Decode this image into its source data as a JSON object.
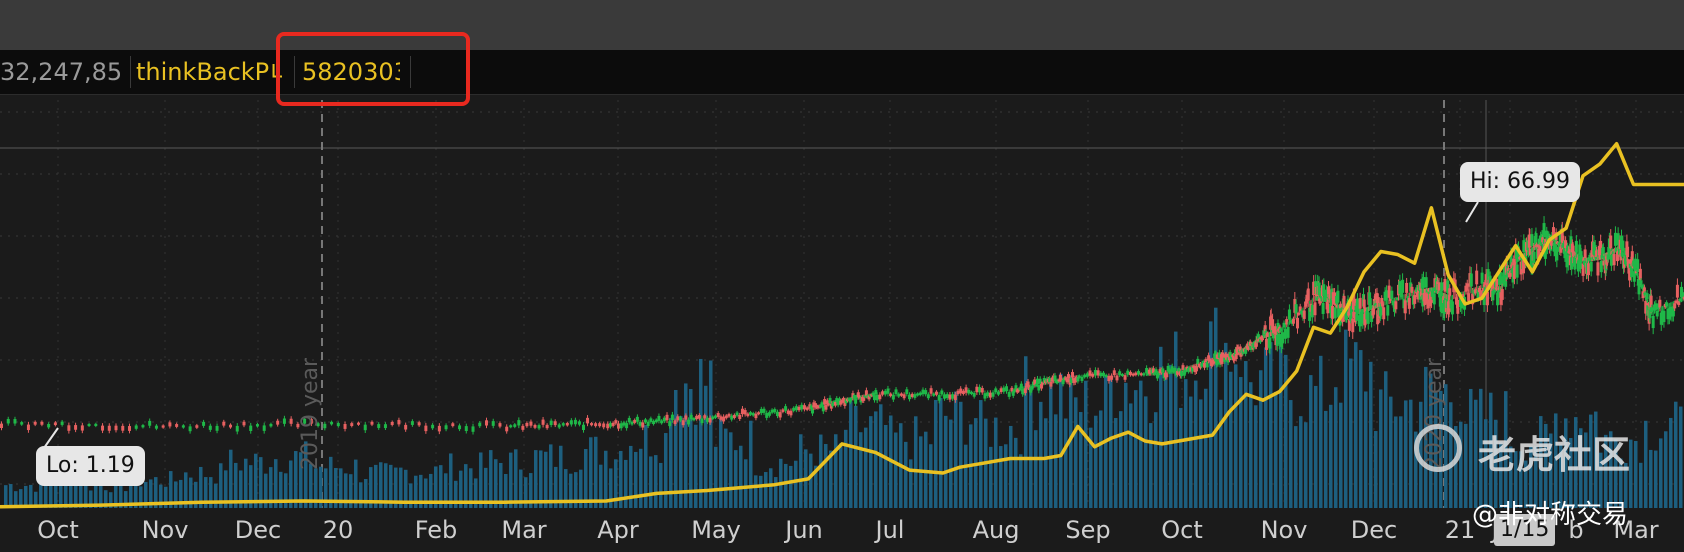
{
  "header": {
    "fields": [
      {
        "label": "32,247,85("
      },
      {
        "label": "thinkBackP∟"
      },
      {
        "label": "5820303"
      }
    ]
  },
  "callouts": {
    "lo": "Lo: 1.19",
    "hi": "Hi: 66.99"
  },
  "year_labels": [
    "2019 year",
    "2020 year"
  ],
  "date_badge": "1/15",
  "watermark": {
    "main": "老虎社区",
    "sub": "@非对称交易"
  },
  "colors": {
    "background": "#1b1b1b",
    "price_line": "#e9c122",
    "candle_up": "#1fb848",
    "candle_down": "#e66060",
    "volume": "#1d5f7f",
    "highlight": "#e8291f"
  },
  "chart_data": {
    "type": "line",
    "title": "",
    "x_ticks": [
      "Oct",
      "Nov",
      "Dec",
      "20",
      "Feb",
      "Mar",
      "Apr",
      "May",
      "Jun",
      "Jul",
      "Aug",
      "Sep",
      "Oct",
      "Nov",
      "Dec",
      "21",
      "Jan",
      "b",
      "Mar"
    ],
    "annotations": {
      "lo": 1.19,
      "hi": 66.99
    },
    "series": [
      {
        "style": "line",
        "x": [
          0,
          6,
          12,
          18,
          24,
          30,
          36,
          39,
          42,
          46,
          48,
          50,
          52,
          54,
          56,
          57,
          58,
          60,
          62,
          63,
          64,
          65,
          66,
          67,
          68,
          69,
          70,
          72,
          73,
          74,
          75,
          76,
          77,
          78,
          79,
          80,
          81,
          82,
          83,
          84,
          85,
          86,
          87,
          88,
          89,
          90,
          91,
          92,
          93,
          94,
          95,
          96,
          97,
          98,
          100
        ],
        "y": [
          0.2,
          0.5,
          1.0,
          1.2,
          1.0,
          1.0,
          1.2,
          2.5,
          3.0,
          4.0,
          5.0,
          11.0,
          9.5,
          6.5,
          6.0,
          7.0,
          7.5,
          8.5,
          8.5,
          9.0,
          14.0,
          10.5,
          12.0,
          13.0,
          11.5,
          11.0,
          11.5,
          12.5,
          16.5,
          19.5,
          18.5,
          20.0,
          23.5,
          31.0,
          30.0,
          34.5,
          40.5,
          44.0,
          43.5,
          42.0,
          51.5,
          40.0,
          35.0,
          36.0,
          40.5,
          45.0,
          40.5,
          46.0,
          48.0,
          57.0,
          59.0,
          62.5,
          55.5,
          55.5,
          55.5
        ]
      },
      {
        "style": "candles",
        "x": [
          0,
          10,
          20,
          30,
          36,
          40,
          44,
          48,
          50,
          52,
          56,
          60,
          62,
          64,
          68,
          70,
          72,
          73,
          74,
          75,
          76,
          78,
          79,
          80,
          81,
          82,
          84,
          85,
          86,
          88,
          89,
          90,
          91,
          92,
          93,
          94,
          95,
          96,
          97,
          98,
          100
        ],
        "y": [
          14.5,
          14.0,
          14.5,
          14.0,
          14.5,
          15.0,
          16.0,
          17.0,
          18.5,
          19.5,
          19.5,
          20.0,
          21.5,
          22.5,
          23.0,
          23.5,
          25.5,
          26.0,
          27.5,
          29.5,
          30.5,
          36.0,
          35.5,
          33.0,
          34.0,
          35.0,
          37.0,
          37.5,
          36.0,
          38.0,
          37.5,
          42.5,
          44.5,
          46.5,
          44.0,
          42.5,
          43.0,
          44.5,
          41.0,
          33.5,
          36.0
        ]
      }
    ],
    "volume": {
      "description_values_relative": [
        0.1,
        0.15,
        0.1,
        0.12,
        0.15,
        0.2,
        0.22,
        0.18,
        0.15,
        0.16,
        0.18,
        0.2,
        0.22,
        0.25,
        0.3,
        0.55,
        0.3,
        0.2,
        0.25,
        0.35,
        0.3,
        0.4,
        0.35,
        0.5,
        0.45,
        0.55,
        0.6,
        0.7,
        0.55,
        0.5,
        0.6,
        0.45,
        0.5,
        0.4,
        0.3,
        0.4,
        0.3,
        0.35
      ]
    }
  }
}
